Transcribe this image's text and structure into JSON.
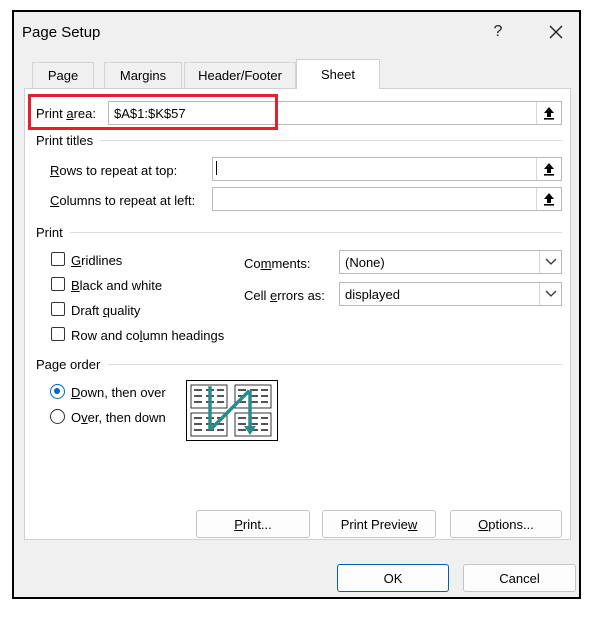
{
  "dialog": {
    "title": "Page Setup",
    "help_label": "?",
    "close_label": "✕"
  },
  "tabs": [
    {
      "label": "Page",
      "active": false
    },
    {
      "label": "Margins",
      "active": false
    },
    {
      "label": "Header/Footer",
      "active": false
    },
    {
      "label": "Sheet",
      "active": true
    }
  ],
  "print_area": {
    "label_prefix": "Print ",
    "label_underlined": "a",
    "label_suffix": "rea:",
    "value": "$A$1:$K$57"
  },
  "print_titles": {
    "section_label": "Print titles",
    "rows": {
      "ul": "R",
      "rest": "ows to repeat at top:",
      "value": ""
    },
    "columns": {
      "ul": "C",
      "rest": "olumns to repeat at left:",
      "value": ""
    }
  },
  "print_section": {
    "section_label": "Print",
    "checkboxes": [
      {
        "pre": "",
        "ul": "G",
        "post": "ridlines",
        "checked": false
      },
      {
        "pre": "",
        "ul": "B",
        "post": "lack and white",
        "checked": false
      },
      {
        "pre": "Draft ",
        "ul": "q",
        "post": "uality",
        "checked": false
      },
      {
        "pre": "Row and co",
        "ul": "l",
        "post": "umn headings",
        "checked": false
      }
    ],
    "comments": {
      "pre": "Co",
      "ul": "m",
      "post": "ments:",
      "value": "(None)"
    },
    "cell_errors": {
      "pre": "Cell ",
      "ul": "e",
      "post": "rrors as:",
      "value": "displayed"
    }
  },
  "page_order": {
    "section_label": "Page order",
    "options": [
      {
        "pre": "",
        "ul": "D",
        "post": "own, then over",
        "checked": true
      },
      {
        "pre": "O",
        "ul": "v",
        "post": "er, then down",
        "checked": false
      }
    ]
  },
  "buttons": {
    "print": {
      "ul": "P",
      "post": "rint..."
    },
    "print_preview": {
      "pre": "Print Previe",
      "ul": "w"
    },
    "options": {
      "ul": "O",
      "post": "ptions..."
    },
    "ok": "OK",
    "cancel": "Cancel"
  },
  "colors": {
    "accent": "#0067c0",
    "highlight": "#e3202b",
    "arrow": "#2a8d8d"
  }
}
